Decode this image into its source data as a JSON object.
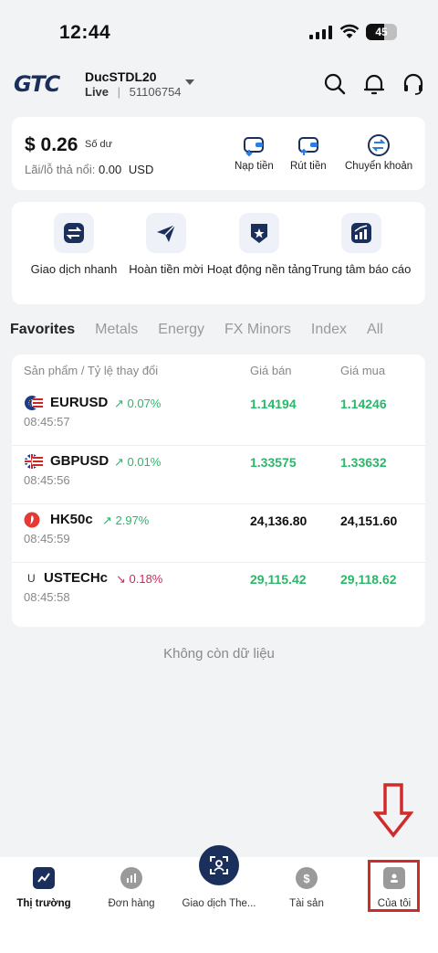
{
  "status_bar": {
    "time": "12:44",
    "battery": "45"
  },
  "header": {
    "logo": "GTC",
    "account_name": "DucSTDL20",
    "account_type": "Live",
    "account_number": "51106754"
  },
  "balance": {
    "amount": "$ 0.26",
    "label": "Số dư",
    "pnl_label": "Lãi/lỗ thả nổi:",
    "pnl_value": "0.00",
    "pnl_currency": "USD",
    "actions": [
      "Nạp tiền",
      "Rút tiền",
      "Chuyển khoản"
    ]
  },
  "shortcuts": {
    "items": [
      {
        "label": "Giao dịch nhanh"
      },
      {
        "label": "Hoàn tiền mời"
      },
      {
        "label": "Hoạt động nền tảng"
      },
      {
        "label": "Trung tâm báo cáo"
      }
    ]
  },
  "tabs": [
    "Favorites",
    "Metals",
    "Energy",
    "FX Minors",
    "Index",
    "All"
  ],
  "market": {
    "headers": {
      "product": "Sản phẩm / Tỷ lệ thay đổi",
      "bid": "Giá bán",
      "ask": "Giá mua"
    },
    "rows": [
      {
        "symbol": "EURUSD",
        "change": "↗ 0.07%",
        "time": "08:45:57",
        "bid": "1.14194",
        "ask": "1.14246"
      },
      {
        "symbol": "GBPUSD",
        "change": "↗ 0.01%",
        "time": "08:45:56",
        "bid": "1.33575",
        "ask": "1.33632"
      },
      {
        "symbol": "HK50c",
        "change": "↗ 2.97%",
        "time": "08:45:59",
        "bid": "24,136.80",
        "ask": "24,151.60"
      },
      {
        "symbol": "USTECHc",
        "change": "↘ 0.18%",
        "time": "08:45:58",
        "bid": "29,115.42",
        "ask": "29,118.62"
      }
    ],
    "no_more": "Không còn dữ liệu"
  },
  "bottom_nav": {
    "items": [
      {
        "label": "Thị trường"
      },
      {
        "label": "Đơn hàng"
      },
      {
        "label": "Giao dịch The..."
      },
      {
        "label": "Tài sản"
      },
      {
        "label": "Của tôi"
      }
    ]
  },
  "colors": {
    "green": "#2cb66a",
    "red": "#d12a2a",
    "navy": "#1a2f5c"
  }
}
